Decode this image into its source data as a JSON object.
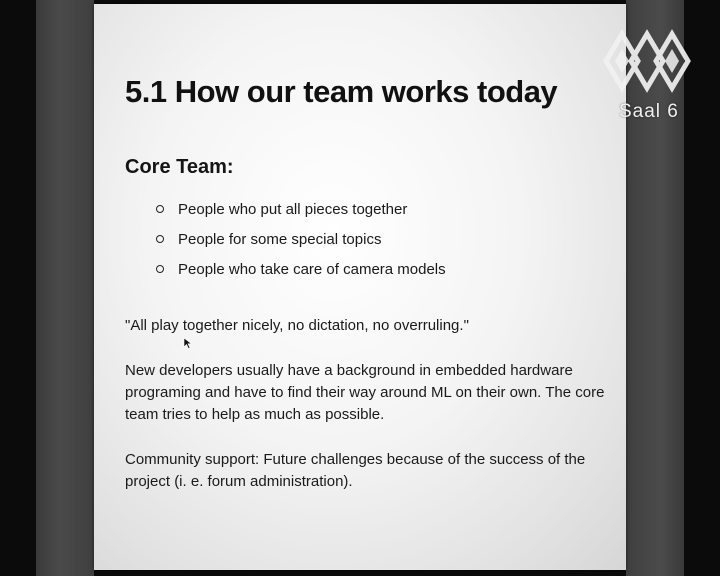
{
  "slide": {
    "title": "5.1 How our team works today",
    "section_heading": "Core Team:",
    "bullets": [
      "People who put all pieces together",
      "People for some special topics",
      "People who take care of camera models"
    ],
    "quote": "\"All play together nicely, no dictation, no overruling.\"",
    "developers_paragraph": "New developers usually have a background in embedded hardware programing and have to find their way around ML on their own. The core team tries to help as much as possible.",
    "community_paragraph": "Community support: Future challenges because of the success of the project (i. e. forum administration)."
  },
  "overlay": {
    "channel_label": "Saal 6",
    "logo_icon": "ccc-cube-logo-icon"
  }
}
